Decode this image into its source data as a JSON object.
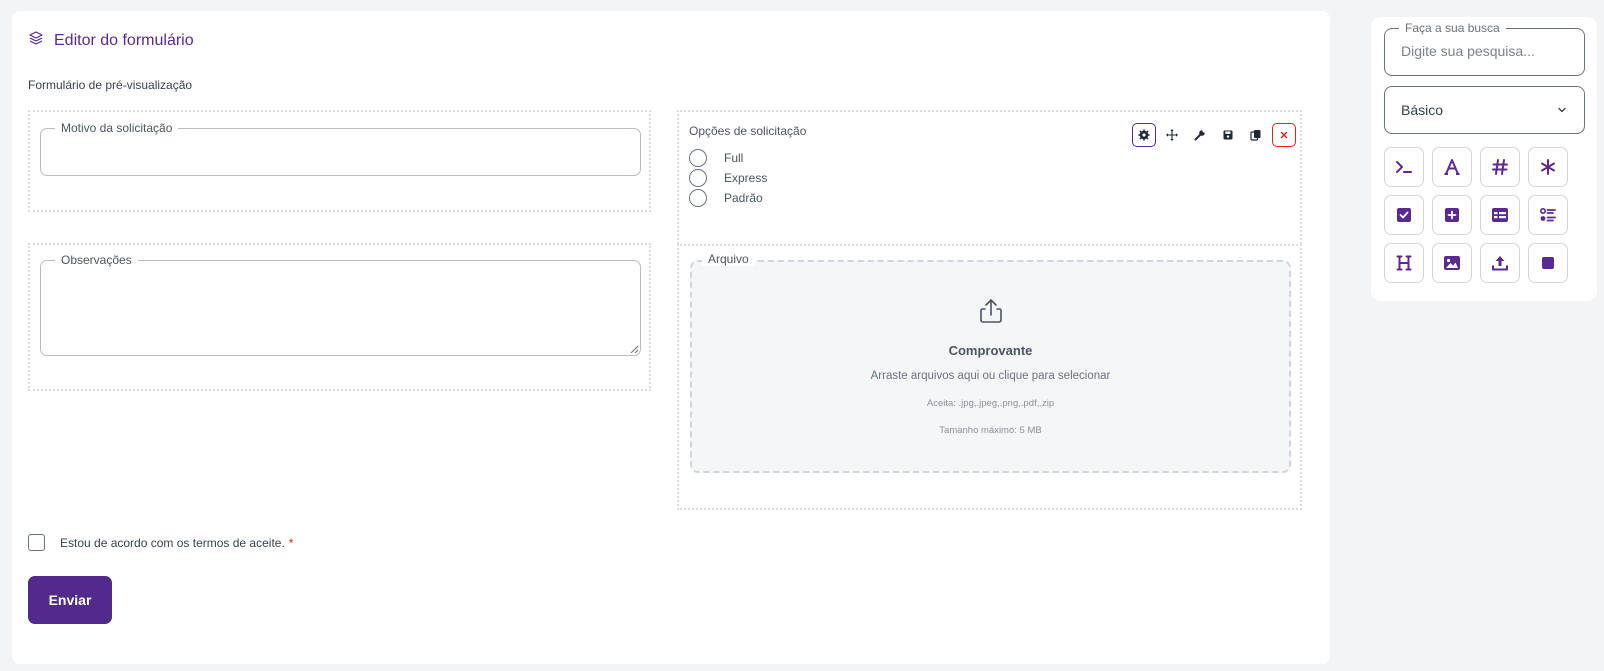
{
  "editor": {
    "title": "Editor do formulário",
    "subtitle": "Formulário de pré-visualização"
  },
  "fields": {
    "motivo_label": "Motivo da solicitação",
    "observacoes_label": "Observações",
    "options_label": "Opções de solicitação",
    "options": [
      "Full",
      "Express",
      "Padrão"
    ],
    "arquivo_label": "Arquivo",
    "upload_title": "Comprovante",
    "upload_desc": "Arraste arquivos aqui ou clique para selecionar",
    "upload_accept": "Aceita: .jpg,.jpeg,.png,.pdf,.zip",
    "upload_max": "Tamanho máximo: 5 MB"
  },
  "toolbar": [
    "gear-icon",
    "move-icon",
    "wrench-icon",
    "save-icon",
    "copy-icon",
    "close-icon"
  ],
  "terms": {
    "label": "Estou de acordo com os termos de aceite.",
    "required_mark": "*"
  },
  "submit_label": "Enviar",
  "panel": {
    "search_legend": "Faça a sua busca",
    "search_placeholder": "Digite sua pesquisa...",
    "category": "Básico",
    "tools": [
      "terminal-icon",
      "font-icon",
      "hash-icon",
      "asterisk-icon",
      "checkbox-icon",
      "plus-square-icon",
      "table-icon",
      "list-icon",
      "heading-icon",
      "image-icon",
      "upload-icon",
      "square-icon"
    ]
  },
  "colors": {
    "accent": "#512a8c",
    "danger": "#dc2626"
  }
}
